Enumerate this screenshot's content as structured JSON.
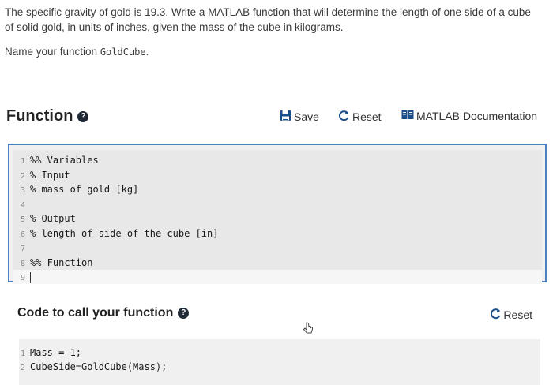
{
  "problem": {
    "line1": "The specific gravity of gold is 19.3. Write a MATLAB function that will determine the length of one side of a cube",
    "line2": "of solid gold, in units of inches, given the mass of the cube in kilograms.",
    "name_prefix": "Name your function ",
    "function_name": "GoldCube",
    "name_suffix": "."
  },
  "function_section": {
    "title": "Function",
    "help_glyph": "?",
    "save_label": "Save",
    "reset_label": "Reset",
    "doc_label": "MATLAB Documentation",
    "lines": [
      {
        "n": "1",
        "text": "%% Variables"
      },
      {
        "n": "2",
        "text": "% Input"
      },
      {
        "n": "3",
        "text": "% mass of gold [kg]"
      },
      {
        "n": "4",
        "text": ""
      },
      {
        "n": "5",
        "text": "% Output"
      },
      {
        "n": "6",
        "text": "% length of side of the cube [in]"
      },
      {
        "n": "7",
        "text": ""
      },
      {
        "n": "8",
        "text": "%% Function"
      },
      {
        "n": "9",
        "text": ""
      }
    ]
  },
  "call_section": {
    "title": "Code to call your function",
    "help_glyph": "?",
    "reset_label": "Reset",
    "lines": [
      {
        "n": "1",
        "text": "Mass = 1;"
      },
      {
        "n": "2",
        "text": "CubeSide=GoldCube(Mass);"
      }
    ]
  },
  "icons": {
    "save": "floppy-disk-icon",
    "reset": "reset-arrow-icon",
    "doc": "book-icon",
    "help": "question-circle-icon",
    "cursor": "mouse-pointer-icon"
  },
  "colors": {
    "editor_border": "#4a7fc1",
    "icon_blue": "#1b4f8a"
  }
}
